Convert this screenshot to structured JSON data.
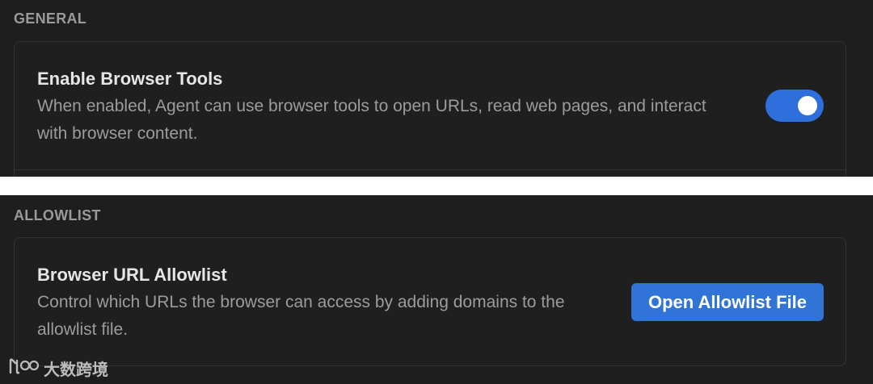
{
  "general": {
    "section_title": "GENERAL",
    "browser_tools": {
      "title": "Enable Browser Tools",
      "description": "When enabled, Agent can use browser tools to open URLs, read web pages, and interact with browser content.",
      "enabled": true,
      "toggle_color": "#2f6fdb"
    }
  },
  "allowlist": {
    "section_title": "ALLOWLIST",
    "url_allowlist": {
      "title": "Browser URL Allowlist",
      "description": "Control which URLs the browser can access by adding domains to the allowlist file.",
      "button_label": "Open Allowlist File",
      "button_color": "#2f74d6"
    }
  },
  "watermark": {
    "text": "大数跨境",
    "icon": "brand-logo-icon"
  }
}
